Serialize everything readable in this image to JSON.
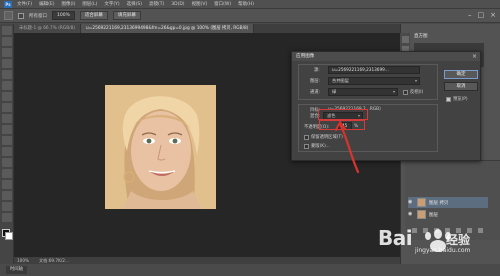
{
  "menubar": {
    "logo": "Ps",
    "items": [
      "文件(F)",
      "编辑(E)",
      "图像(I)",
      "图层(L)",
      "文字(Y)",
      "选择(S)",
      "滤镜(T)",
      "3D(D)",
      "视图(V)",
      "窗口(W)",
      "帮助(H)"
    ]
  },
  "options": {
    "sample_all_windows": "所有窗口",
    "zoom": "100%",
    "fit_screen": "适合屏幕",
    "fill_screen": "填充屏幕"
  },
  "tabs": [
    "未标题-1 @ 66.7% (RGB/8)",
    "u=2569221169,2313699498&fm=26&gp=0.jpg @ 100% (图层 拷贝, RGB/8)"
  ],
  "status": {
    "zoom": "100%",
    "doc": "文档:69.7K/2..."
  },
  "bottom_tab": "时间轴",
  "right_panel": {
    "header": "直方图",
    "layers": [
      {
        "name": "图层 拷贝",
        "selected": true
      },
      {
        "name": "图层",
        "selected": false
      }
    ]
  },
  "dialog": {
    "title": "应用图像",
    "source_label": "源:",
    "source_value": "u=2569221169,2313699...",
    "layer_label": "图层:",
    "layer_value": "合并图层",
    "channel_label": "通道:",
    "channel_value": "绿",
    "invert_label": "反相(I)",
    "target_label": "目标:",
    "target_value": "u=2569221169,2...RGB)",
    "blending_label": "混合:",
    "blending_value": "滤色",
    "opacity_label": "不透明度(O):",
    "opacity_value": "45",
    "opacity_unit": "%",
    "preserve_label": "保留透明区域(T)",
    "mask_label": "蒙版(K)...",
    "ok_label": "确定",
    "cancel_label": "取消",
    "preview_label": "预览(P)",
    "preview_checked": true
  },
  "watermark": {
    "brand": "Bai",
    "brand_suffix": "经验",
    "url": "jingyan.baidu.com"
  }
}
